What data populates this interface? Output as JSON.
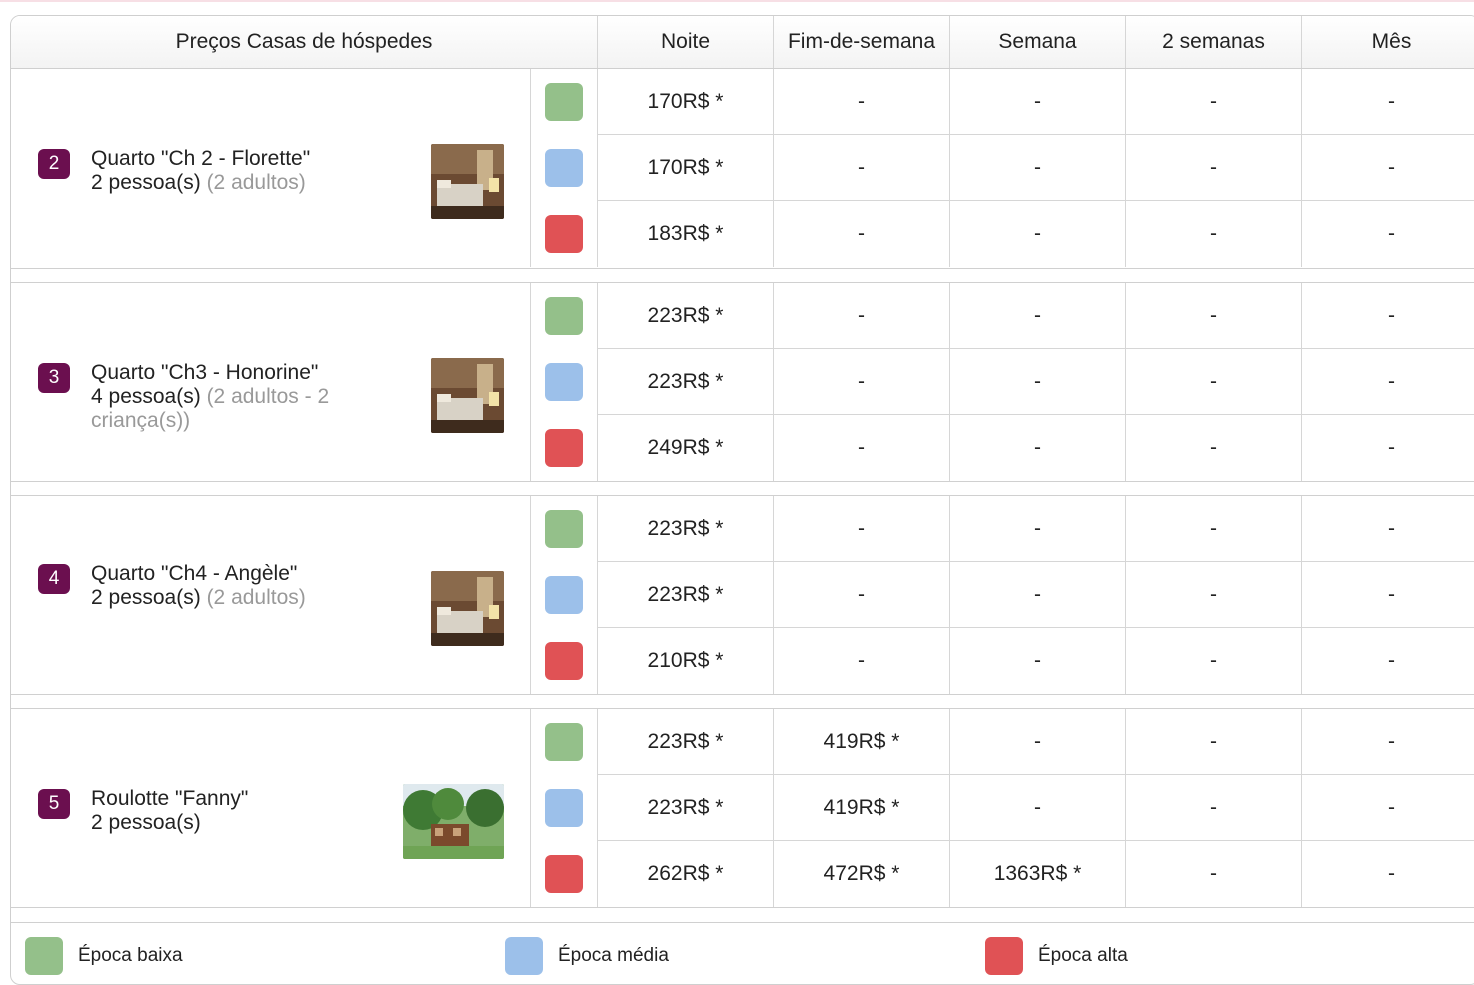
{
  "colors": {
    "low": "#94c08a",
    "mid": "#9cc0ea",
    "high": "#e05255",
    "badge": "#6b0f4f"
  },
  "header": {
    "title": "Preços Casas de hóspedes",
    "columns": [
      "Noite",
      "Fim-de-semana",
      "Semana",
      "2 semanas",
      "Mês"
    ]
  },
  "rooms": [
    {
      "number": "2",
      "name": "Quarto \"Ch 2 - Florette\"",
      "capacity": "2 pessoa(s)",
      "detail": "(2 adultos)",
      "photo": "bedroom-photo",
      "rates": [
        [
          "170R$ *",
          "-",
          "-",
          "-",
          "-"
        ],
        [
          "170R$ *",
          "-",
          "-",
          "-",
          "-"
        ],
        [
          "183R$ *",
          "-",
          "-",
          "-",
          "-"
        ]
      ]
    },
    {
      "number": "3",
      "name": "Quarto \"Ch3  - Honorine\"",
      "capacity": "4 pessoa(s)",
      "detail": "(2 adultos - 2 criança(s))",
      "photo": "bedroom-photo",
      "rates": [
        [
          "223R$ *",
          "-",
          "-",
          "-",
          "-"
        ],
        [
          "223R$ *",
          "-",
          "-",
          "-",
          "-"
        ],
        [
          "249R$ *",
          "-",
          "-",
          "-",
          "-"
        ]
      ]
    },
    {
      "number": "4",
      "name": "Quarto \"Ch4  -  Angèle\"",
      "capacity": "2 pessoa(s)",
      "detail": "(2 adultos)",
      "photo": "bedroom-photo",
      "rates": [
        [
          "223R$ *",
          "-",
          "-",
          "-",
          "-"
        ],
        [
          "223R$ *",
          "-",
          "-",
          "-",
          "-"
        ],
        [
          "210R$ *",
          "-",
          "-",
          "-",
          "-"
        ]
      ]
    },
    {
      "number": "5",
      "name": "Roulotte \"Fanny\"",
      "capacity": "2 pessoa(s)",
      "detail": "",
      "photo": "garden-caravan-photo",
      "rates": [
        [
          "223R$ *",
          "419R$ *",
          "-",
          "-",
          "-"
        ],
        [
          "223R$ *",
          "419R$ *",
          "-",
          "-",
          "-"
        ],
        [
          "262R$ *",
          "472R$ *",
          "1363R$ *",
          "-",
          "-"
        ]
      ]
    }
  ],
  "legend": [
    {
      "label": "Época baixa",
      "color": "#94c08a"
    },
    {
      "label": "Época média",
      "color": "#9cc0ea"
    },
    {
      "label": "Época alta",
      "color": "#e05255"
    }
  ]
}
